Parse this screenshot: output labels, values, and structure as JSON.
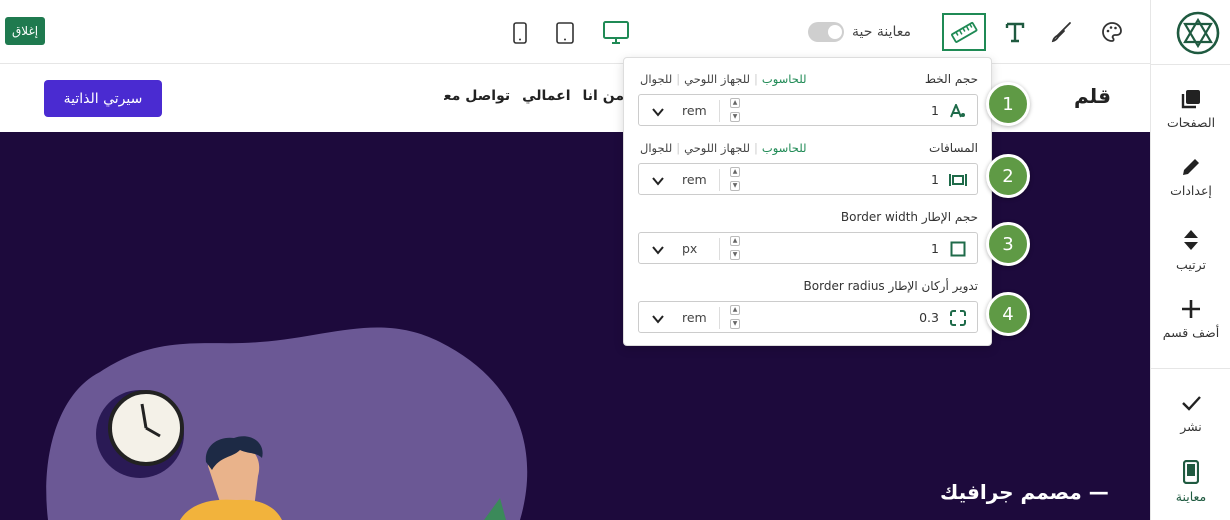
{
  "toolbar": {
    "close_label": "إغلاق",
    "live_preview_label": "معاينة حية",
    "live_preview_on": false,
    "devices": [
      "mobile",
      "tablet",
      "desktop"
    ],
    "active_device": "desktop",
    "tools": [
      "ruler-icon",
      "text-icon",
      "brush-icon",
      "palette-icon"
    ],
    "active_tool": "ruler-icon",
    "accent_color": "#1f8a55"
  },
  "sidebar": {
    "items": [
      {
        "label": "الصفحات",
        "icon": "pages-icon"
      },
      {
        "label": "إعدادات",
        "icon": "pencil-icon"
      },
      {
        "label": "ترتيب",
        "icon": "sort-icon"
      },
      {
        "label": "أضف قسم",
        "icon": "plus-icon"
      },
      {
        "label": "نشر",
        "icon": "check-icon"
      },
      {
        "label": "معاينة",
        "icon": "mobile-preview-icon"
      }
    ]
  },
  "site": {
    "brand": "قلم",
    "nav": [
      "من انا",
      "اعمالي",
      "تواصل معي"
    ],
    "cta": "سيرتي الذاتية",
    "hero_title": "— مصمم جرافيك",
    "hero_bg": "#1d0a3c",
    "cta_color": "#4a2bd1"
  },
  "panel": {
    "device_links": {
      "desktop": "للحاسوب",
      "tablet": "للجهاز اللوحي",
      "mobile": "للجوال"
    },
    "rows": [
      {
        "label": "حجم الخط",
        "value": "1",
        "unit": "rem",
        "icon": "font-size-icon",
        "show_devices": true
      },
      {
        "label": "المسافات",
        "value": "1",
        "unit": "rem",
        "icon": "spacing-icon",
        "show_devices": true
      },
      {
        "label": "حجم الإطار Border width",
        "value": "1",
        "unit": "px",
        "icon": "border-width-icon",
        "show_devices": false
      },
      {
        "label": "تدوير أركان الإطار Border radius",
        "value": "0.3",
        "unit": "rem",
        "icon": "border-radius-icon",
        "show_devices": false
      }
    ]
  },
  "badges": [
    "1",
    "2",
    "3",
    "4"
  ]
}
